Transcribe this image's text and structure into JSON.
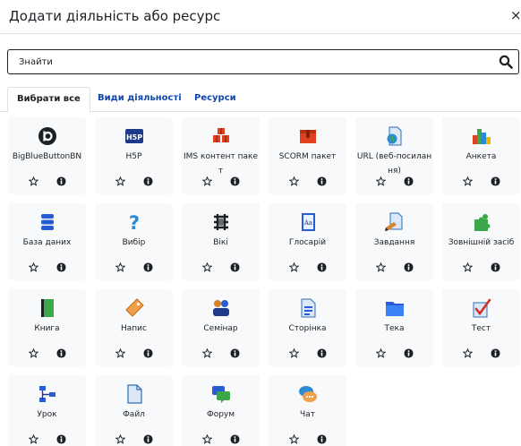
{
  "dialog": {
    "title": "Додати діяльність або ресурс",
    "close_glyph": "×"
  },
  "search": {
    "placeholder": "Знайти",
    "icon": "search-icon"
  },
  "tabs": [
    {
      "label": "Вибрати все",
      "active": true
    },
    {
      "label": "Види діяльності",
      "active": false
    },
    {
      "label": "Ресурси",
      "active": false
    }
  ],
  "colors": {
    "link": "#0f47ad",
    "text": "#1d2125",
    "tile_bg": "#f8f9fa",
    "border": "#dee2e6"
  },
  "modules": [
    {
      "label": "BigBlueButtonBN",
      "icon": "bigbluebutton-icon"
    },
    {
      "label": "H5P",
      "icon": "h5p-icon"
    },
    {
      "label": "IMS контент пакет",
      "icon": "ims-package-icon"
    },
    {
      "label": "SCORM пакет",
      "icon": "scorm-package-icon"
    },
    {
      "label": "URL (веб-посилання)",
      "icon": "url-icon"
    },
    {
      "label": "Анкета",
      "icon": "feedback-chart-icon"
    },
    {
      "label": "База даних",
      "icon": "database-icon"
    },
    {
      "label": "Вибір",
      "icon": "choice-question-icon"
    },
    {
      "label": "Вікі",
      "icon": "wiki-icon"
    },
    {
      "label": "Глосарій",
      "icon": "glossary-icon"
    },
    {
      "label": "Завдання",
      "icon": "assignment-icon"
    },
    {
      "label": "Зовнішній засіб",
      "icon": "external-tool-icon"
    },
    {
      "label": "Книга",
      "icon": "book-icon"
    },
    {
      "label": "Напис",
      "icon": "label-tag-icon"
    },
    {
      "label": "Семінар",
      "icon": "workshop-icon"
    },
    {
      "label": "Сторінка",
      "icon": "page-icon"
    },
    {
      "label": "Тека",
      "icon": "folder-icon"
    },
    {
      "label": "Тест",
      "icon": "quiz-icon"
    },
    {
      "label": "Урок",
      "icon": "lesson-icon"
    },
    {
      "label": "Файл",
      "icon": "file-icon"
    },
    {
      "label": "Форум",
      "icon": "forum-icon"
    },
    {
      "label": "Чат",
      "icon": "chat-icon"
    }
  ],
  "tile_actions": {
    "star_icon": "star-icon",
    "info_icon": "info-icon"
  }
}
